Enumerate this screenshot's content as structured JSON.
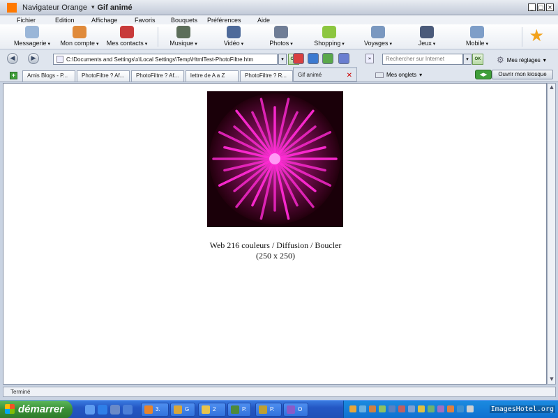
{
  "titlebar": {
    "app_name": "Navigateur Orange",
    "doc_title": "Gif animé",
    "separator": "▾"
  },
  "menu": [
    "Fichier",
    "Edition",
    "Affichage",
    "Favoris",
    "Bouquets",
    "Préférences",
    "Aide"
  ],
  "toolbar": {
    "items": [
      {
        "label": "Messagerie",
        "icon": "envelope-icon",
        "color": "#9ab6d8"
      },
      {
        "label": "Mon compte",
        "icon": "account-icon",
        "color": "#e08a3a"
      },
      {
        "label": "Mes contacts",
        "icon": "contacts-icon",
        "color": "#c83a3a"
      },
      {
        "label": "Musique",
        "icon": "music-icon",
        "color": "#5c6e5a"
      },
      {
        "label": "Vidéo",
        "icon": "video-icon",
        "color": "#4e6a9a"
      },
      {
        "label": "Photos",
        "icon": "camera-icon",
        "color": "#6f7d96"
      },
      {
        "label": "Shopping",
        "icon": "shopping-icon",
        "color": "#8cc63f"
      },
      {
        "label": "Voyages",
        "icon": "plane-icon",
        "color": "#7a98c0"
      },
      {
        "label": "Jeux",
        "icon": "joystick-icon",
        "color": "#4a5a7a"
      },
      {
        "label": "Mobile",
        "icon": "mobile-icon",
        "color": "#7e9ec8"
      }
    ],
    "favorites_icon": "star-icon"
  },
  "address": {
    "url": "C:\\Documents and Settings\\x\\Local Settings\\Temp\\HtmlTest-PhotoFiltre.htm",
    "go_label": "OK",
    "more": "»"
  },
  "search": {
    "placeholder": "Rechercher sur Internet",
    "go_label": "OK"
  },
  "settings_label": "Mes réglages",
  "tabs": [
    {
      "label": "Amis Blogs - P..."
    },
    {
      "label": "PhotoFiltre ? Af..."
    },
    {
      "label": "PhotoFiltre ? Af..."
    },
    {
      "label": "lettre de A a Z"
    },
    {
      "label": "PhotoFiltre ? R..."
    },
    {
      "label": "Gif animé",
      "active": true
    }
  ],
  "tab_close": "✕",
  "new_tab": "+",
  "onglets_label": "Mes onglets",
  "kiosque_label": "Ouvrir mon kiosque",
  "page": {
    "caption_line1": "Web 216 couleurs / Diffusion / Boucler",
    "caption_line2": "(250 x 250)"
  },
  "status": "Terminé",
  "taskbar": {
    "start_label": "démarrer",
    "tasks": [
      {
        "label": "3.",
        "color": "#e8842c"
      },
      {
        "label": "G",
        "color": "#d9a63a"
      },
      {
        "label": "2",
        "color": "#e8c34a"
      },
      {
        "label": "P.",
        "color": "#4e8a3a"
      },
      {
        "label": "P.",
        "color": "#c0a030"
      },
      {
        "label": "O",
        "color": "#8a5ac8"
      }
    ]
  },
  "watermark": "ImagesHotel.org",
  "colors": {
    "orange": "#ff7900",
    "burst": "#ff2ad4",
    "burst_bg": "#1a0009"
  }
}
